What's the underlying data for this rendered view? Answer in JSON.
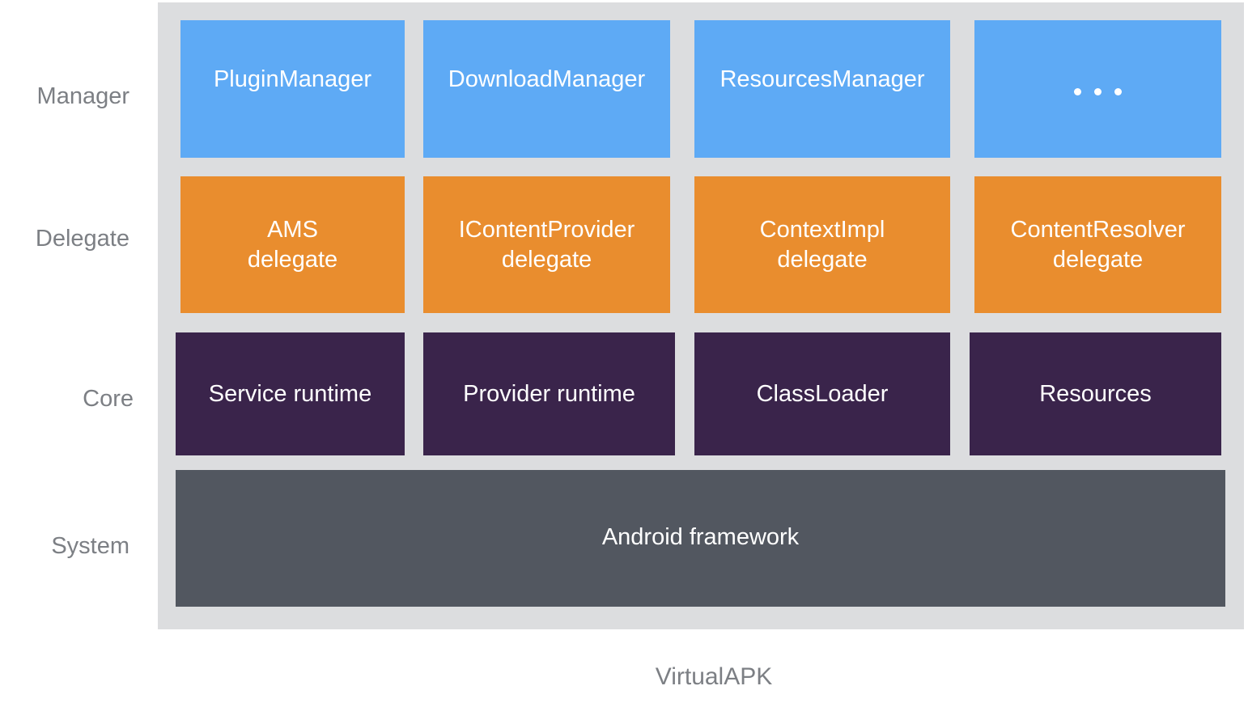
{
  "diagram": {
    "title": "VirtualAPK",
    "colors": {
      "panel": "#dcdddf",
      "manager": "#5eaaf5",
      "delegate": "#e98d2e",
      "core": "#3a244b",
      "system": "#525760",
      "label_text": "#7c7f84",
      "box_text": "#ffffff"
    },
    "layers": [
      {
        "label": "Manager",
        "items": [
          "PluginManager",
          "DownloadManager",
          "ResourcesManager",
          "..."
        ]
      },
      {
        "label": "Delegate",
        "items": [
          "AMS\ndelegate",
          "IContentProvider\ndelegate",
          "ContextImpl\ndelegate",
          "ContentResolver\ndelegate"
        ]
      },
      {
        "label": "Core",
        "items": [
          "Service runtime",
          "Provider runtime",
          "ClassLoader",
          "Resources"
        ]
      },
      {
        "label": "System",
        "items": [
          "Android framework"
        ]
      }
    ]
  }
}
